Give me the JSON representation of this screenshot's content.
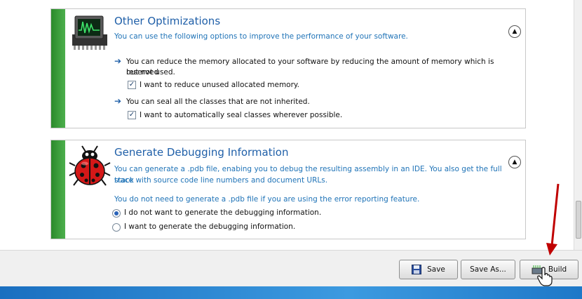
{
  "other_optimizations": {
    "title": "Other Optimizations",
    "description": "You can use the following options to improve the performance of your software.",
    "item1_line1": "You can reduce the memory allocated to your software by reducing the amount of memory which is reserved",
    "item1_line2": "but not used.",
    "item1_checkbox": "I want to reduce unused allocated memory.",
    "item2_text": "You can seal all the classes that are not inherited.",
    "item2_checkbox": "I want to automatically seal classes wherever possible."
  },
  "debugging": {
    "title": "Generate Debugging Information",
    "desc_line1": "You can generate a .pdb file, enabing you to debug the resulting assembly in an IDE. You also get the full stack",
    "desc_line2": "trace with source code line numbers and document URLs.",
    "note": "You do not need to generate a .pdb file if you are using the error reporting feature.",
    "option_no": "I do not want to generate the debugging information.",
    "option_yes": "I want to generate the debugging information."
  },
  "footer": {
    "save_label": "Save",
    "save_as_label": "Save As...",
    "build_label": "Build"
  },
  "icons": {
    "optimizations": "chip-icon",
    "debugging": "ladybug-icon",
    "collapse": "chevron-up-icon",
    "save": "floppy-disk-icon",
    "build": "build-icon"
  },
  "colors": {
    "accent_green": "#2b8a2b",
    "title_blue": "#1f5fa8",
    "link_blue": "#1f73b7",
    "annotation_red": "#c00000"
  }
}
